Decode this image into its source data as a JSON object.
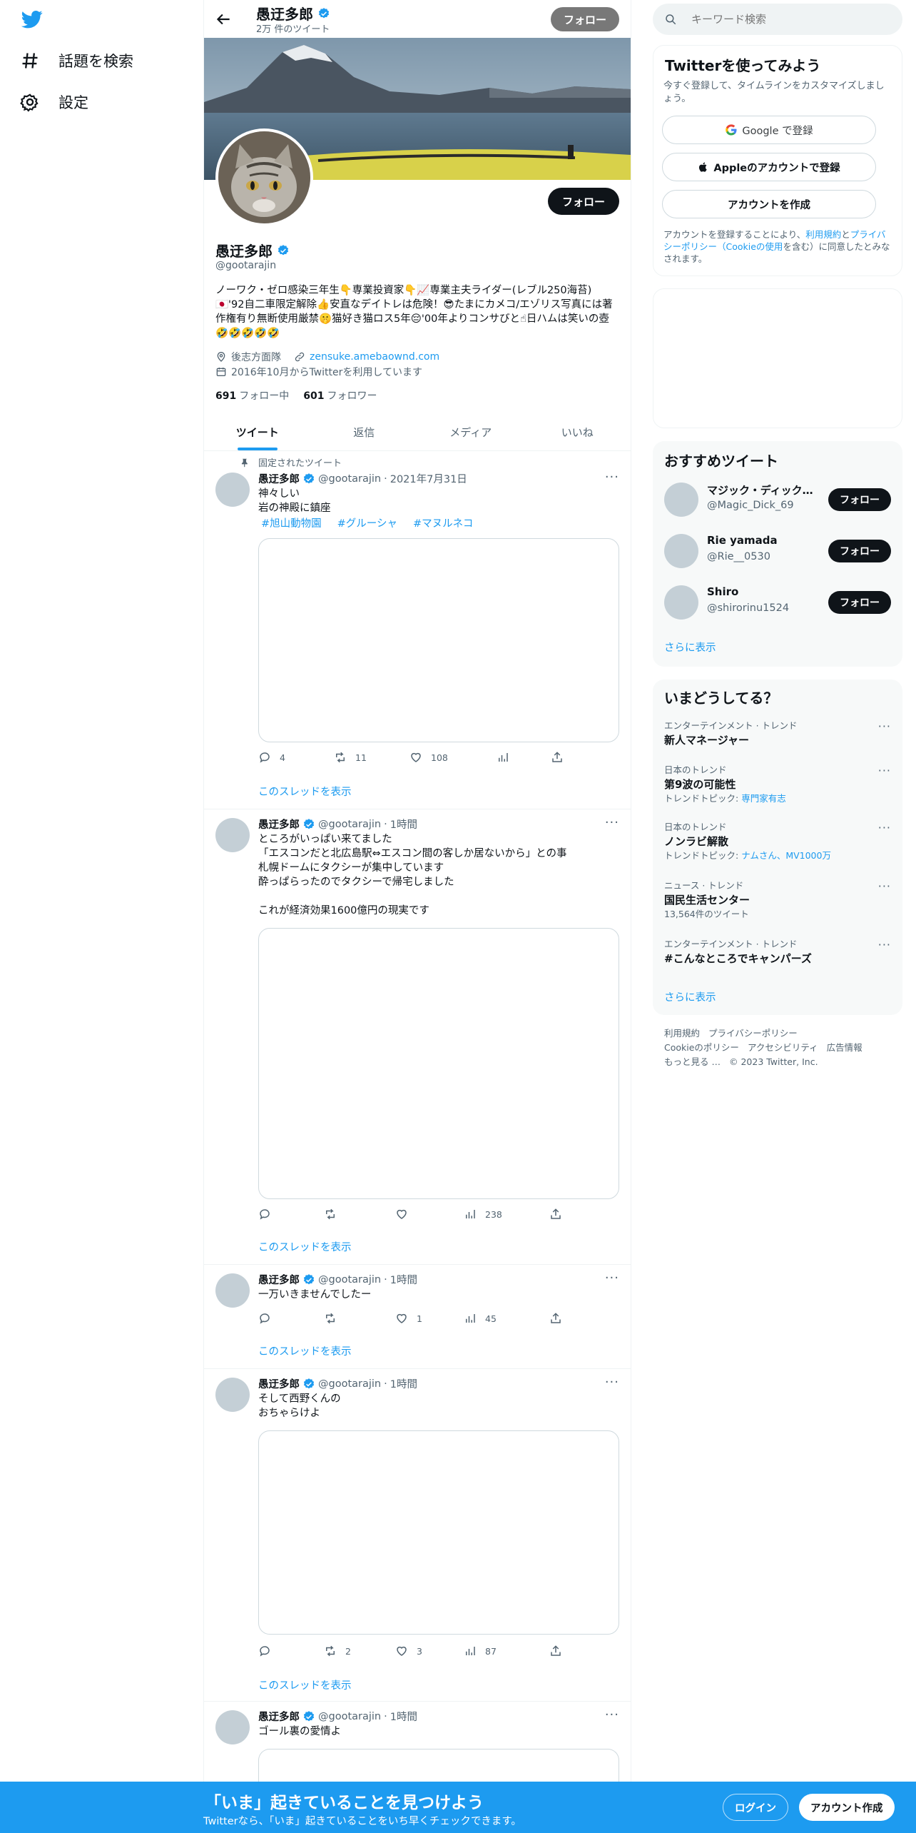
{
  "nav": {
    "explore_label": "話題を検索",
    "settings_label": "設定"
  },
  "header": {
    "name": "愚迂多郎",
    "tweet_count": "2万 件のツイート",
    "follow_label": "フォロー"
  },
  "profile": {
    "name": "愚迂多郎",
    "handle": "@gootarajin",
    "follow_label": "フォロー",
    "bio": "ノーワク・ゼロ感染三年生👇専業投資家👇📈専業主夫ライダー(レブル250海苔)🇯🇵'92自二車限定解除👍安直なデイトレは危険！😎たまにカメコ/エゾリス写真には著作権有り無断使用厳禁🤫猫好き猫ロス5年😔'00年よりコンサびと☝日ハムは笑いの壺🤣🤣🤣🤣🤣",
    "location": "後志方面隊",
    "url": "zensuke.amebaownd.com",
    "joined": "2016年10月からTwitterを利用しています",
    "following_count": "691",
    "following_label": "フォロー中",
    "followers_count": "601",
    "followers_label": "フォロワー"
  },
  "tabs": [
    "ツイート",
    "返信",
    "メディア",
    "いいね"
  ],
  "pinned_label": "固定されたツイート",
  "thread_label": "このスレッドを表示",
  "tweets": [
    {
      "name": "愚迂多郎",
      "handle": "@gootarajin",
      "time": "2021年7月31日",
      "text": "神々しい\n岩の神殿に鎮座",
      "tags": [
        "#旭山動物園",
        "#グルーシャ",
        "#マヌルネコ"
      ],
      "replies": "4",
      "retweets": "11",
      "likes": "108",
      "views": ""
    },
    {
      "name": "愚迂多郎",
      "handle": "@gootarajin",
      "time": "1時間",
      "text": "ところがいっぱい来てました\n「エスコンだと北広島駅⇔エスコン間の客しか居ないから」との事\n札幌ドームにタクシーが集中しています\n酔っぱらったのでタクシーで帰宅しました\n\nこれが経済効果1600億円の現実です",
      "replies": "",
      "retweets": "",
      "likes": "",
      "views": "238"
    },
    {
      "name": "愚迂多郎",
      "handle": "@gootarajin",
      "time": "1時間",
      "text": "一万いきませんでしたー",
      "replies": "",
      "retweets": "",
      "likes": "1",
      "views": "45"
    },
    {
      "name": "愚迂多郎",
      "handle": "@gootarajin",
      "time": "1時間",
      "text": "そして西野くんの\nおちゃらけよ",
      "replies": "",
      "retweets": "2",
      "likes": "3",
      "views": "87"
    },
    {
      "name": "愚迂多郎",
      "handle": "@gootarajin",
      "time": "1時間",
      "text": "ゴール裏の愛情よ"
    }
  ],
  "right": {
    "search_placeholder": "キーワード検索",
    "signup": {
      "title": "Twitterを使ってみよう",
      "subtitle": "今すぐ登録して、タイムラインをカスタマイズしましょう。",
      "google_label": "Google で登録",
      "apple_label": "Appleのアカウントで登録",
      "create_label": "アカウントを作成",
      "legal_prefix": "アカウントを登録することにより、",
      "legal_terms": "利用規約",
      "legal_and": "と",
      "legal_privacy": "プライバシーポリシー（Cookieの使用",
      "legal_suffix": "を含む）に同意したとみなされます。"
    },
    "recommend": {
      "title": "おすすめツイート",
      "follow_label": "フォロー",
      "show_more": "さらに表示",
      "users": [
        {
          "name": "マジック・ディックの…",
          "handle": "@Magic_Dick_69"
        },
        {
          "name": "Rie yamada",
          "handle": "@Rie__0530"
        },
        {
          "name": "Shiro",
          "handle": "@shirorinu1524"
        }
      ]
    },
    "trends": {
      "title": "いまどうしてる？",
      "show_more": "さらに表示",
      "items": [
        {
          "context": "エンターテインメント · トレンド",
          "title": "新人マネージャー",
          "extra_prefix": "",
          "extra_link": ""
        },
        {
          "context": "日本のトレンド",
          "title": "第9波の可能性",
          "extra_prefix": "トレンドトピック: ",
          "extra_link": "専門家有志"
        },
        {
          "context": "日本のトレンド",
          "title": "ノンラビ解散",
          "extra_prefix": "トレンドトピック: ",
          "extra_link": "ナムさん、MV1000万"
        },
        {
          "context": "ニュース · トレンド",
          "title": "国民生活センター",
          "extra_prefix": "13,564件のツイート",
          "extra_link": ""
        },
        {
          "context": "エンターテインメント · トレンド",
          "title": "#こんなところでキャンパーズ",
          "extra_prefix": "",
          "extra_link": ""
        }
      ]
    },
    "footer": {
      "terms": "利用規約",
      "privacy": "プライバシーポリシー",
      "cookie": "Cookieのポリシー",
      "accessibility": "アクセシビリティ",
      "ads": "広告情報",
      "more": "もっと見る …",
      "copyright": "© 2023 Twitter, Inc."
    }
  },
  "bottom_bar": {
    "title": "「いま」起きていることを見つけよう",
    "subtitle": "Twitterなら、「いま」起きていることをいち早くチェックできます。",
    "login_label": "ログイン",
    "signup_label": "アカウント作成"
  },
  "colors": {
    "accent": "#1d9bf0",
    "text": "#0f1419",
    "muted": "#536471"
  }
}
